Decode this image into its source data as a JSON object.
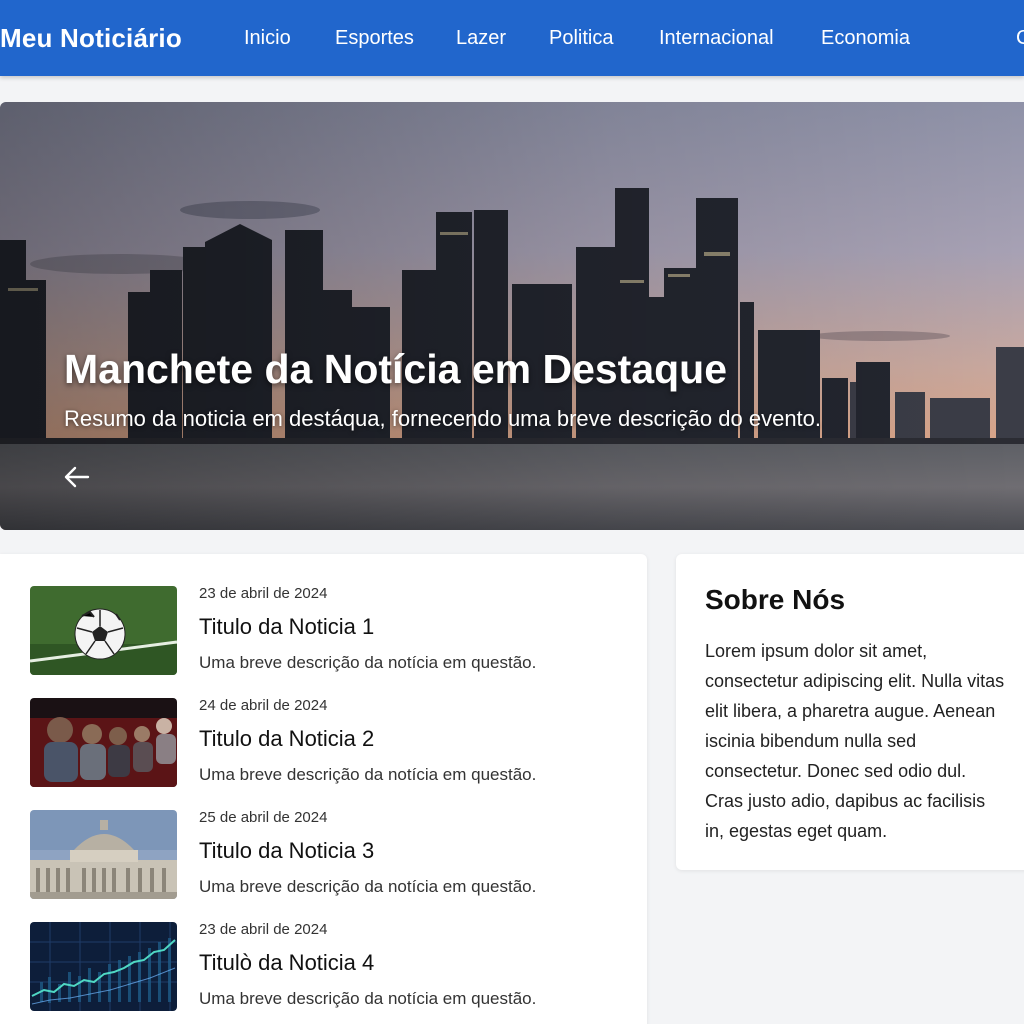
{
  "header": {
    "brand": "Meu Noticiário",
    "nav": [
      "Inicio",
      "Esportes",
      "Lazer",
      "Politica",
      "Internacional",
      "Economia"
    ],
    "nav_extra": "C",
    "accent": "#2166cc"
  },
  "hero": {
    "title": "Manchete da Notícia em Destaque",
    "summary": "Resumo da noticia em destáqua, fornecendo uma breve descrição do evento.",
    "prev_icon": "arrow-left-icon"
  },
  "news": [
    {
      "date": "23 de abril de 2024",
      "title": "Titulo da Noticia 1",
      "description": "Uma breve descrição da notícia em questão.",
      "image": "soccer-ball"
    },
    {
      "date": "24 de abril de 2024",
      "title": "Titulo da Noticia 2",
      "description": "Uma breve descrição da notícia em questão.",
      "image": "cinema-audience"
    },
    {
      "date": "25 de abril de 2024",
      "title": "Titulo da Noticia 3",
      "description": "Uma breve descrição da notícia em questão.",
      "image": "capitol-building"
    },
    {
      "date": "23 de abril de 2024",
      "title": "Titulò da Noticia 4",
      "description": "Uma breve descrição da notícia em questão.",
      "image": "stock-chart"
    }
  ],
  "about": {
    "title": "Sobre Nós",
    "text": "Lorem ipsum dolor sit amet, consectetur adipiscing elit. Nulla vitas elit libera, a pharetra augue. Aenean iscinia bibendum nulla sed consectetur. Donec sed odio dul. Cras justo adio, dapibus ac facilisis in, egestas eget quam."
  }
}
